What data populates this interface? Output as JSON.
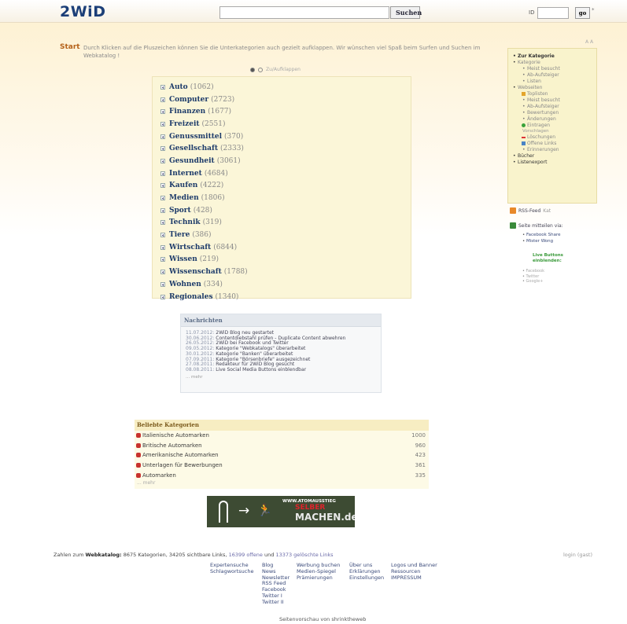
{
  "header": {
    "logo": "2WiD",
    "search_placeholder": "",
    "search_button": "Suchen",
    "id_label": "ID",
    "go_button": "go",
    "star": "*"
  },
  "intro": {
    "start": "Start",
    "text": "Durch Klicken auf die Pluszeichen können Sie die Unterkategorien auch gezielt aufklappen. Wir wünschen viel Spaß beim Surfen und Suchen im Webkatalog !",
    "font_toggle": "A A",
    "toggle_label": "Zu/Aufklappen"
  },
  "categories": [
    {
      "name": "Auto",
      "count": "(1062)"
    },
    {
      "name": "Computer",
      "count": "(2723)"
    },
    {
      "name": "Finanzen",
      "count": "(1677)"
    },
    {
      "name": "Freizeit",
      "count": "(2551)"
    },
    {
      "name": "Genussmittel",
      "count": "(370)"
    },
    {
      "name": "Gesellschaft",
      "count": "(2333)"
    },
    {
      "name": "Gesundheit",
      "count": "(3061)"
    },
    {
      "name": "Internet",
      "count": "(4684)"
    },
    {
      "name": "Kaufen",
      "count": "(4222)"
    },
    {
      "name": "Medien",
      "count": "(1806)"
    },
    {
      "name": "Sport",
      "count": "(428)"
    },
    {
      "name": "Technik",
      "count": "(319)"
    },
    {
      "name": "Tiere",
      "count": "(386)"
    },
    {
      "name": "Wirtschaft",
      "count": "(6844)"
    },
    {
      "name": "Wissen",
      "count": "(219)"
    },
    {
      "name": "Wissenschaft",
      "count": "(1788)"
    },
    {
      "name": "Wohnen",
      "count": "(334)"
    },
    {
      "name": "Regionales",
      "count": "(1340)"
    }
  ],
  "news": {
    "title": "Nachrichten",
    "items": [
      {
        "date": "11.07.2012:",
        "text": "2WiD Blog neu gestartet"
      },
      {
        "date": "30.06.2012:",
        "text": "Contentdiebstahl prüfen - Duplicate Content abwehren"
      },
      {
        "date": "26.05.2012:",
        "text": "2WiD bei Facebook und Twitter"
      },
      {
        "date": "09.05.2012:",
        "text": "Kategorie \"Webkatalogs\" überarbeitet"
      },
      {
        "date": "30.01.2012:",
        "text": "Kategorie \"Banken\" überarbeitet"
      },
      {
        "date": "07.09.2011:",
        "text": "Kategorie \"Börsenbriefe\" ausgezeichnet"
      },
      {
        "date": "27.08.2011:",
        "text": "Redakteur für 2WiD Blog gesucht"
      },
      {
        "date": "08.08.2011:",
        "text": "Live Social Media Buttons einblendbar"
      }
    ],
    "more": "... mehr"
  },
  "popular": {
    "title": "Beliebte Kategorien",
    "items": [
      {
        "name": "Italienische Automarken",
        "count": "1000"
      },
      {
        "name": "Britische Automarken",
        "count": "960"
      },
      {
        "name": "Amerikanische Automarken",
        "count": "423"
      },
      {
        "name": "Unterlagen für Bewerbungen",
        "count": "361"
      },
      {
        "name": "Automarken",
        "count": "335"
      }
    ],
    "more": "... mehr"
  },
  "banner": {
    "line1": "WWW.ATOMAUSSTIEG",
    "line2": "SELBER",
    "line3": "MACHEN.de"
  },
  "stats": {
    "prefix": "Zahlen zum",
    "brand": "Webkatalog:",
    "text1": "8675 Kategorien, 34205 sichtbare Links,",
    "offene": "16399 offene",
    "und": "und",
    "geloescht": "13373 gelöschte Links"
  },
  "login": "login (gast)",
  "footer": {
    "col1": [
      "Expertensuche",
      "Schlagwortsuche"
    ],
    "col2": [
      "Blog",
      "News",
      "Newsletter",
      "RSS Feed",
      "Facebook",
      "Twitter I",
      "Twitter II"
    ],
    "col3": [
      "Werbung buchen",
      "Medien-Spiegel",
      "Prämierungen"
    ],
    "col4": [
      "Über uns",
      "Erklärungen",
      "Einstellungen"
    ],
    "col5": [
      "Logos und Banner",
      "Ressourcen",
      "IMPRESSUM"
    ]
  },
  "preview_credit": "Seitenvorschau von shrinktheweb",
  "sidebar": {
    "zur_kategorie": "Zur Kategorie",
    "kategorie": "Kategorie",
    "kategorie_sub": [
      "Meist besucht",
      "Ab-Aufsteiger",
      "Listen"
    ],
    "webseiten": "Webseiten",
    "toplisten": "Toplisten",
    "webseiten_sub": [
      "Meist besucht",
      "Ab-Aufsteiger",
      "Bewertungen",
      "Änderungen"
    ],
    "eintragen": "Eintragen",
    "vorschlagen": "Vorschlagen",
    "loeschungen": "Löschungen",
    "offene_links": "Offene Links",
    "erinnerungen": "Erinnerungen",
    "buecher": "Bücher",
    "listenexport": "Listenexport"
  },
  "rss": {
    "label": "RSS-Feed",
    "sub": "Kat"
  },
  "share": {
    "label": "Seite mitteilen via:",
    "items": [
      "Facebook Share",
      "Mister Wong"
    ],
    "live_buttons": [
      "Live Buttons",
      "einblenden:"
    ],
    "live_items": [
      "Facebook",
      "Twitter",
      "Google+"
    ]
  }
}
